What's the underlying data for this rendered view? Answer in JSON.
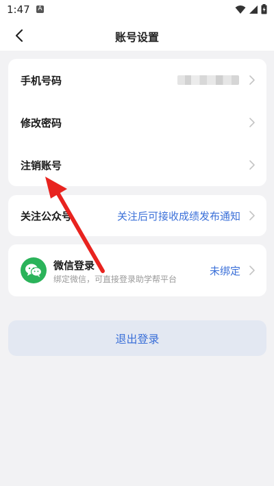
{
  "status_bar": {
    "time": "1:47",
    "notification_badge": "A"
  },
  "header": {
    "title": "账号设置",
    "back_icon": "chevron-left-icon"
  },
  "account_section": {
    "items": [
      {
        "label": "手机号码",
        "value_masked": true
      },
      {
        "label": "修改密码"
      },
      {
        "label": "注销账号"
      }
    ]
  },
  "follow_section": {
    "label": "关注公众号",
    "value": "关注后可接收成绩发布通知"
  },
  "wechat_section": {
    "title": "微信登录",
    "subtitle": "绑定微信，可直接登录助学帮平台",
    "status": "未绑定",
    "icon": "wechat-icon"
  },
  "logout_label": "退出登录",
  "colors": {
    "accent_blue": "#3a6fd8",
    "wechat_green": "#2bb35a",
    "annotation_red": "#e8231f",
    "background": "#f2f2f4"
  }
}
